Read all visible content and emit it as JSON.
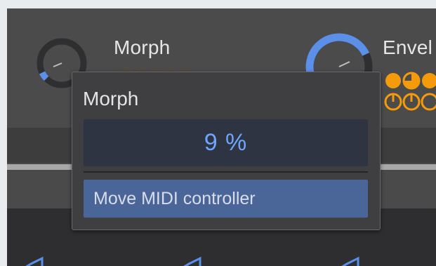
{
  "knobs": [
    {
      "label": "Morph",
      "level": 0.09
    },
    {
      "label": "Envel",
      "level": 0.62
    }
  ],
  "popup": {
    "title": "Morph",
    "value": "9 %",
    "midi_button": "Move MIDI controller"
  },
  "colors": {
    "accent_blue": "#5b8fe8",
    "orange": "#f59b0b",
    "value_text": "#6fa5ff",
    "midi_button_bg": "#4a6699"
  }
}
